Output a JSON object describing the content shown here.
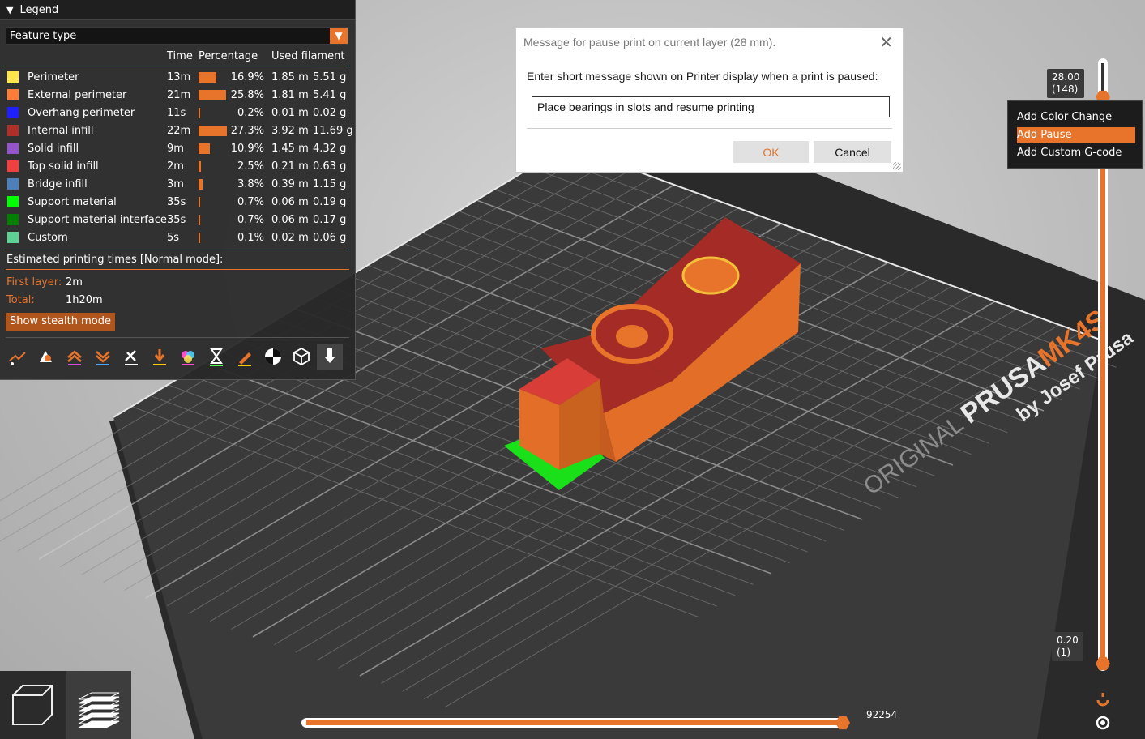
{
  "legend": {
    "title": "Legend",
    "view_type": "Feature type",
    "columns": {
      "time": "Time",
      "percentage": "Percentage",
      "used_filament": "Used filament"
    },
    "rows": [
      {
        "name": "Perimeter",
        "color": "#ffe64d",
        "time": "13m",
        "percent": "16.9%",
        "length": "1.85 m",
        "weight": "5.51 g",
        "fraction": 0.169
      },
      {
        "name": "External perimeter",
        "color": "#ff7d38",
        "time": "21m",
        "percent": "25.8%",
        "length": "1.81 m",
        "weight": "5.41 g",
        "fraction": 0.258
      },
      {
        "name": "Overhang perimeter",
        "color": "#1f1fff",
        "time": "11s",
        "percent": "0.2%",
        "length": "0.01 m",
        "weight": "0.02 g",
        "fraction": 0.002
      },
      {
        "name": "Internal infill",
        "color": "#b03029",
        "time": "22m",
        "percent": "27.3%",
        "length": "3.92 m",
        "weight": "11.69 g",
        "fraction": 0.273
      },
      {
        "name": "Solid infill",
        "color": "#9654cc",
        "time": "9m",
        "percent": "10.9%",
        "length": "1.45 m",
        "weight": "4.32 g",
        "fraction": 0.109
      },
      {
        "name": "Top solid infill",
        "color": "#f04040",
        "time": "2m",
        "percent": "2.5%",
        "length": "0.21 m",
        "weight": "0.63 g",
        "fraction": 0.025
      },
      {
        "name": "Bridge infill",
        "color": "#4d80ba",
        "time": "3m",
        "percent": "3.8%",
        "length": "0.39 m",
        "weight": "1.15 g",
        "fraction": 0.038
      },
      {
        "name": "Support material",
        "color": "#00ff00",
        "time": "35s",
        "percent": "0.7%",
        "length": "0.06 m",
        "weight": "0.19 g",
        "fraction": 0.007
      },
      {
        "name": "Support material interface",
        "color": "#008000",
        "time": "35s",
        "percent": "0.7%",
        "length": "0.06 m",
        "weight": "0.17 g",
        "fraction": 0.007
      },
      {
        "name": "Custom",
        "color": "#5ed194",
        "time": "5s",
        "percent": "0.1%",
        "length": "0.02 m",
        "weight": "0.06 g",
        "fraction": 0.001
      }
    ],
    "estimated_label": "Estimated printing times [Normal mode]:",
    "first_layer_label": "First layer:",
    "first_layer_value": "2m",
    "total_label": "Total:",
    "total_value": "1h20m",
    "stealth_button": "Show stealth mode",
    "toolbar_icons": [
      "travel-icon",
      "wipe-icon",
      "retractions-icon",
      "deretractions-icon",
      "seams-icon",
      "tool-changes-icon",
      "color-changes-icon",
      "pause-prints-icon",
      "custom-gcode-icon",
      "center-of-gravity-icon",
      "shells-icon",
      "tool-marker-icon"
    ]
  },
  "dialog": {
    "title": "Message for pause print on current layer (28 mm).",
    "prompt": "Enter short message shown on Printer display when a print is paused:",
    "input_value": "Place bearings in slots and resume printing",
    "ok_label": "OK",
    "cancel_label": "Cancel"
  },
  "layer_slider": {
    "top_value": "28.00",
    "top_layer": "(148)",
    "bottom_value": "0.20",
    "bottom_layer": "(1)"
  },
  "context_menu": {
    "items": [
      {
        "label": "Add Color Change",
        "selected": false
      },
      {
        "label": "Add Pause",
        "selected": true
      },
      {
        "label": "Add Custom G-code",
        "selected": false
      }
    ]
  },
  "move_slider": {
    "value": "92254"
  },
  "bed": {
    "brand_small": "ORIGINAL",
    "brand_big": "PRUSA",
    "model": "MK4S",
    "by": "by Josef Prusa"
  },
  "colors": {
    "accent": "#e8742b",
    "panel": "#282828"
  }
}
